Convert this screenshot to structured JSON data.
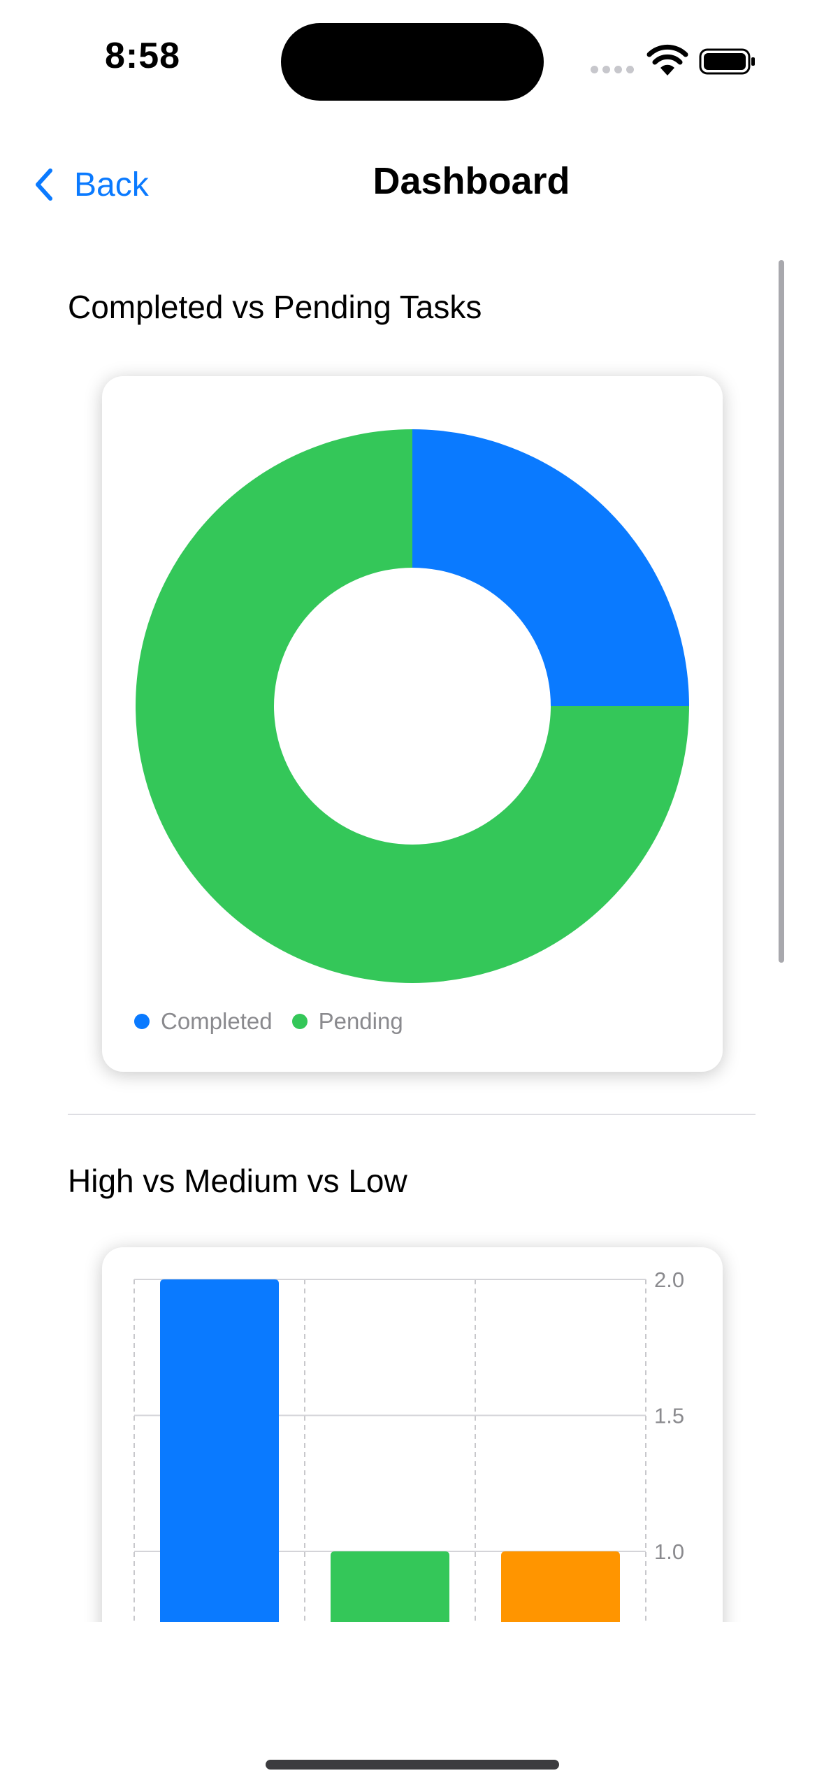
{
  "status_bar": {
    "time": "8:58"
  },
  "nav": {
    "back_label": "Back",
    "title": "Dashboard"
  },
  "colors": {
    "accent": "#0a7aff",
    "blue": "#0a7aff",
    "green": "#34c759",
    "orange": "#ff9500"
  },
  "icons": [
    "chevron-left-icon",
    "wifi-icon",
    "battery-icon",
    "cellular-signal-icon"
  ],
  "sections": [
    {
      "title": "Completed vs Pending Tasks"
    },
    {
      "title": "High vs Medium vs Low"
    }
  ],
  "chart_data": [
    {
      "type": "pie",
      "donut": true,
      "categories": [
        "Completed",
        "Pending"
      ],
      "values": [
        1,
        3
      ],
      "colors": [
        "#0a7aff",
        "#34c759"
      ],
      "legend": [
        "Completed",
        "Pending"
      ],
      "legend_position": "bottom-left"
    },
    {
      "type": "bar",
      "values": [
        2.0,
        1.0,
        1.0
      ],
      "colors": [
        "#0a7aff",
        "#34c759",
        "#ff9500"
      ],
      "y_ticks": [
        "2.0",
        "1.5",
        "1.0"
      ],
      "y_tick_values": [
        2.0,
        1.5,
        1.0
      ],
      "y_axis_side": "right",
      "grid": true
    }
  ]
}
